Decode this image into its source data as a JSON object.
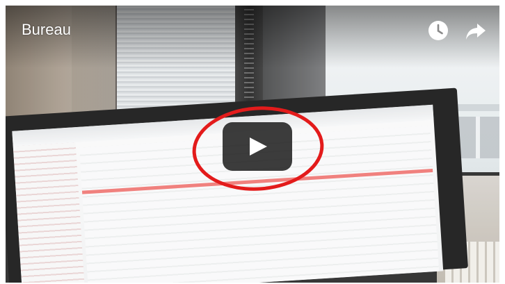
{
  "video": {
    "title": "Bureau"
  },
  "controls": {
    "watch_later_icon": "clock-icon",
    "share_icon": "share-arrow-icon",
    "play_icon": "play-icon"
  },
  "colors": {
    "overlay_text": "#ffffff",
    "play_button_bg": "#212121",
    "annotation_circle": "#e31b1b"
  }
}
